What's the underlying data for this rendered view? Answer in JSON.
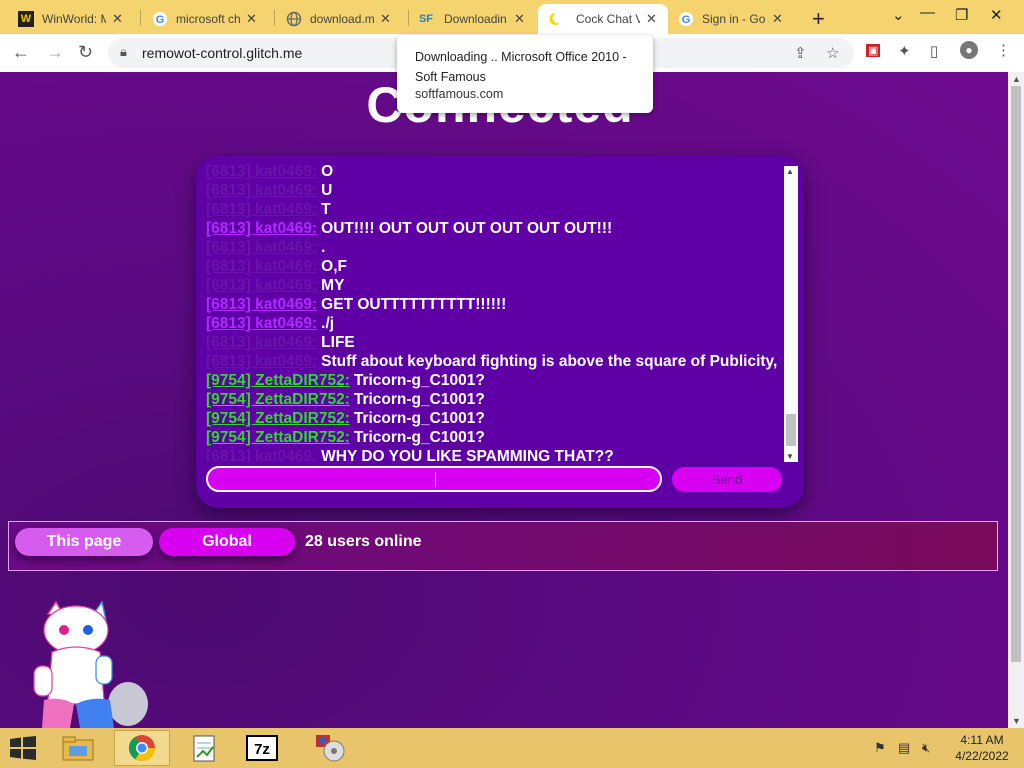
{
  "browser": {
    "tabs": [
      {
        "title": "WinWorld: M",
        "favicon": "W"
      },
      {
        "title": "microsoft ch",
        "favicon": "G"
      },
      {
        "title": "download.m",
        "favicon": "globe"
      },
      {
        "title": "Downloadin",
        "favicon": "SF"
      },
      {
        "title": "Cock Chat V",
        "favicon": "moon"
      },
      {
        "title": "Sign in - Go",
        "favicon": "G"
      }
    ],
    "url": "remowot-control.glitch.me",
    "tooltip": {
      "title": "Downloading .. Microsoft Office 2010 - Soft Famous",
      "domain": "softfamous.com"
    }
  },
  "page": {
    "heading": "Connected",
    "messages": [
      {
        "user": "[6813] kat0469:",
        "color": "hidden",
        "text": "O"
      },
      {
        "user": "[6813] kat0469:",
        "color": "hidden",
        "text": "U"
      },
      {
        "user": "[6813] kat0469:",
        "color": "hidden",
        "text": "T"
      },
      {
        "user": "[6813] kat0469:",
        "color": "purple",
        "text": "OUT!!!! OUT OUT OUT OUT OUT OUT!!!"
      },
      {
        "user": "[6813] kat0469:",
        "color": "hidden",
        "text": "."
      },
      {
        "user": "[6813] kat0469:",
        "color": "hidden",
        "text": "O,F"
      },
      {
        "user": "[6813] kat0469:",
        "color": "hidden",
        "text": "MY"
      },
      {
        "user": "[6813] kat0469:",
        "color": "purple",
        "text": "GET OUTTTTTTTTTT!!!!!!"
      },
      {
        "user": "[6813] kat0469:",
        "color": "purple",
        "text": "./j"
      },
      {
        "user": "[6813] kat0469:",
        "color": "hidden",
        "text": "LIFE"
      },
      {
        "user": "[6813] kat0469:",
        "color": "hidden",
        "text": "Stuff about keyboard fighting is above the square of Publicity,"
      },
      {
        "user": "[9754] ZettaDIR752:",
        "color": "green",
        "text": "Tricorn-g_C1001?"
      },
      {
        "user": "[9754] ZettaDIR752:",
        "color": "green",
        "text": "Tricorn-g_C1001?"
      },
      {
        "user": "[9754] ZettaDIR752:",
        "color": "green",
        "text": "Tricorn-g_C1001?"
      },
      {
        "user": "[9754] ZettaDIR752:",
        "color": "green",
        "text": "Tricorn-g_C1001?"
      },
      {
        "user": "[6813] kat0469:",
        "color": "hidden",
        "text": "WHY DO YOU LIKE SPAMMING THAT??"
      }
    ],
    "input_value": "",
    "send_label": "Send",
    "scope_buttons": {
      "this_page": "This page",
      "global": "Global"
    },
    "online": "28 users online"
  },
  "taskbar": {
    "apps": [
      "file-explorer",
      "chrome",
      "notepad",
      "7zip",
      "media-center"
    ],
    "time": "4:11 AM",
    "date": "4/22/2022"
  },
  "colors": {
    "page_bg": "#6b0a8a",
    "chatbox": "#5e00a6",
    "accent": "#d800f0",
    "username_purple": "#b02aff",
    "username_green": "#2fd92b",
    "tabbar": "#f5d470",
    "taskbar": "#e8c56a"
  }
}
